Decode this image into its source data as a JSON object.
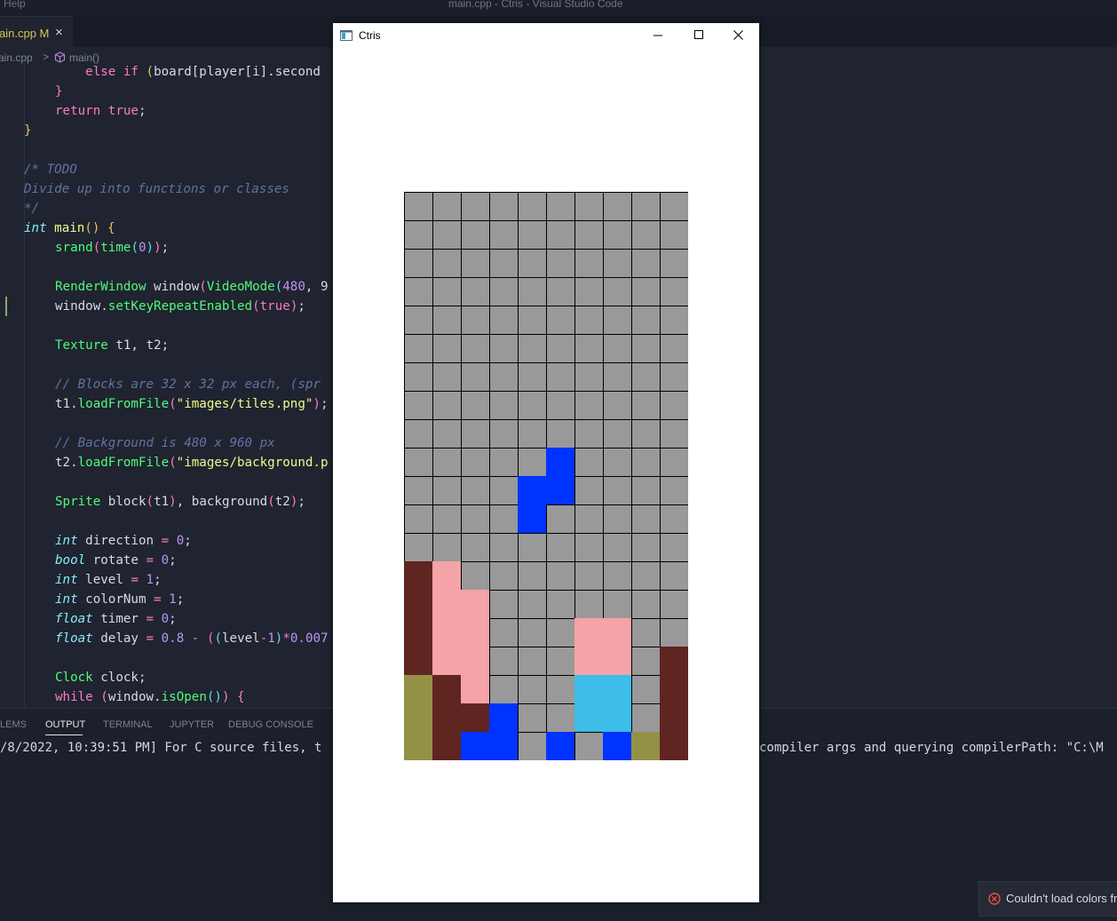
{
  "vscode": {
    "menu_help": "Help",
    "window_title": "main.cpp - Ctris - Visual Studio Code",
    "tab": {
      "label": "ain.cpp M",
      "close": "×"
    },
    "breadcrumb": {
      "file": "ain.cpp",
      "separator": ">",
      "symbol": "main()"
    },
    "panel_tabs": [
      "LEMS",
      "OUTPUT",
      "TERMINAL",
      "JUPYTER",
      "DEBUG CONSOLE"
    ],
    "output_line_left": "/8/2022, 10:39:51 PM] For C source files, t",
    "output_line_right": "compiler args and querying compilerPath: \"C:\\M",
    "toast_text": "Couldn't load colors fr"
  },
  "ctris": {
    "title": "Ctris",
    "colors": {
      "empty": "#999999",
      "brown": "#5f2520",
      "pink": "#f4a3a6",
      "blue": "#0033ff",
      "cyan": "#3dbde8",
      "olive": "#939145"
    },
    "board": [
      "..........",
      "..........",
      "..........",
      "..........",
      "..........",
      "..........",
      "..........",
      "..........",
      "..........",
      ".....B....",
      "....BB....",
      "....B.....",
      "..........",
      "RP........",
      "RPP.......",
      "RPP...PP..",
      "RPP...PP.R",
      "ORP...CC.R",
      "ORRB..CC.R",
      "ORBB.B.BOR"
    ]
  }
}
